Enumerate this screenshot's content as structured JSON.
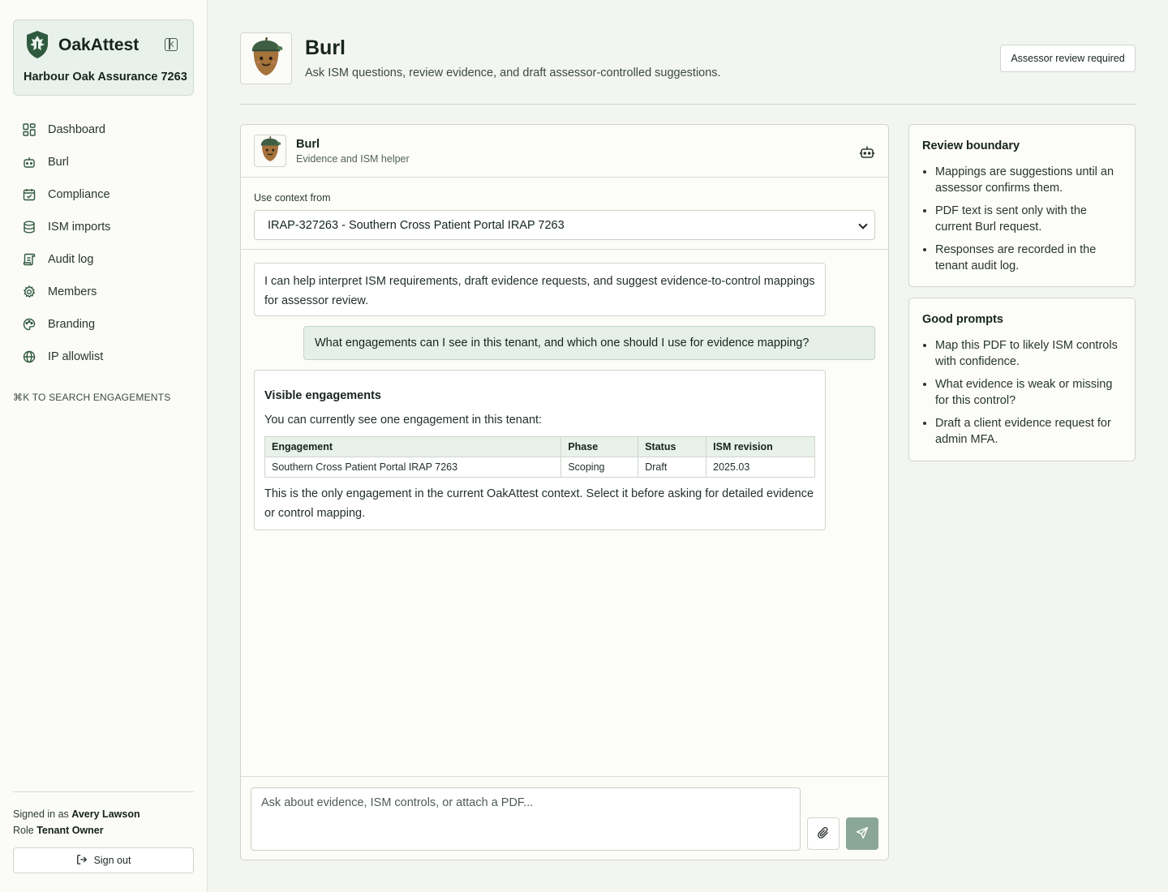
{
  "app": {
    "brand_name": "OakAttest",
    "tenant_name": "Harbour Oak Assurance 7263"
  },
  "sidebar": {
    "items": [
      {
        "label": "Dashboard",
        "icon": "dashboard-grid-icon"
      },
      {
        "label": "Burl",
        "icon": "robot-icon"
      },
      {
        "label": "Compliance",
        "icon": "calendar-check-icon"
      },
      {
        "label": "ISM imports",
        "icon": "database-icon"
      },
      {
        "label": "Audit log",
        "icon": "scroll-icon"
      },
      {
        "label": "Members",
        "icon": "gear-icon"
      },
      {
        "label": "Branding",
        "icon": "palette-icon"
      },
      {
        "label": "IP allowlist",
        "icon": "globe-icon"
      }
    ],
    "search_hint": "⌘K TO SEARCH ENGAGEMENTS",
    "signed_in_label": "Signed in as",
    "user_name": "Avery Lawson",
    "role_label": "Role",
    "role_value": "Tenant Owner",
    "sign_out_label": "Sign out"
  },
  "header": {
    "title": "Burl",
    "subtitle": "Ask ISM questions, review evidence, and draft assessor-controlled suggestions.",
    "badge": "Assessor review required"
  },
  "chat": {
    "assistant_name": "Burl",
    "assistant_role": "Evidence and ISM helper",
    "context_label": "Use context from",
    "context_selected": "IRAP-327263 - Southern Cross Patient Portal IRAP 7263",
    "messages": {
      "intro": "I can help interpret ISM requirements, draft evidence requests, and suggest evidence-to-control mappings for assessor review.",
      "user_question": "What engagements can I see in this tenant, and which one should I use for evidence mapping?",
      "reply_heading": "Visible engagements",
      "reply_intro": "You can currently see one engagement in this tenant:",
      "table_headers": [
        "Engagement",
        "Phase",
        "Status",
        "ISM revision"
      ],
      "table_rows": [
        [
          "Southern Cross Patient Portal IRAP 7263",
          "Scoping",
          "Draft",
          "2025.03"
        ]
      ],
      "reply_outro": "This is the only engagement in the current OakAttest context. Select it before asking for detailed evidence or control mapping."
    },
    "composer_placeholder": "Ask about evidence, ISM controls, or attach a PDF..."
  },
  "review_boundary": {
    "title": "Review boundary",
    "items": [
      "Mappings are suggestions until an assessor confirms them.",
      "PDF text is sent only with the current Burl request.",
      "Responses are recorded in the tenant audit log."
    ]
  },
  "good_prompts": {
    "title": "Good prompts",
    "items": [
      "Map this PDF to likely ISM controls with confidence.",
      "What evidence is weak or missing for this control?",
      "Draft a client evidence request for admin MFA."
    ]
  },
  "colors": {
    "brand_green": "#2f5a3f",
    "accent_light": "#e6f0e8",
    "send_button": "#8aa795",
    "page_bg": "#f3f5f1"
  }
}
